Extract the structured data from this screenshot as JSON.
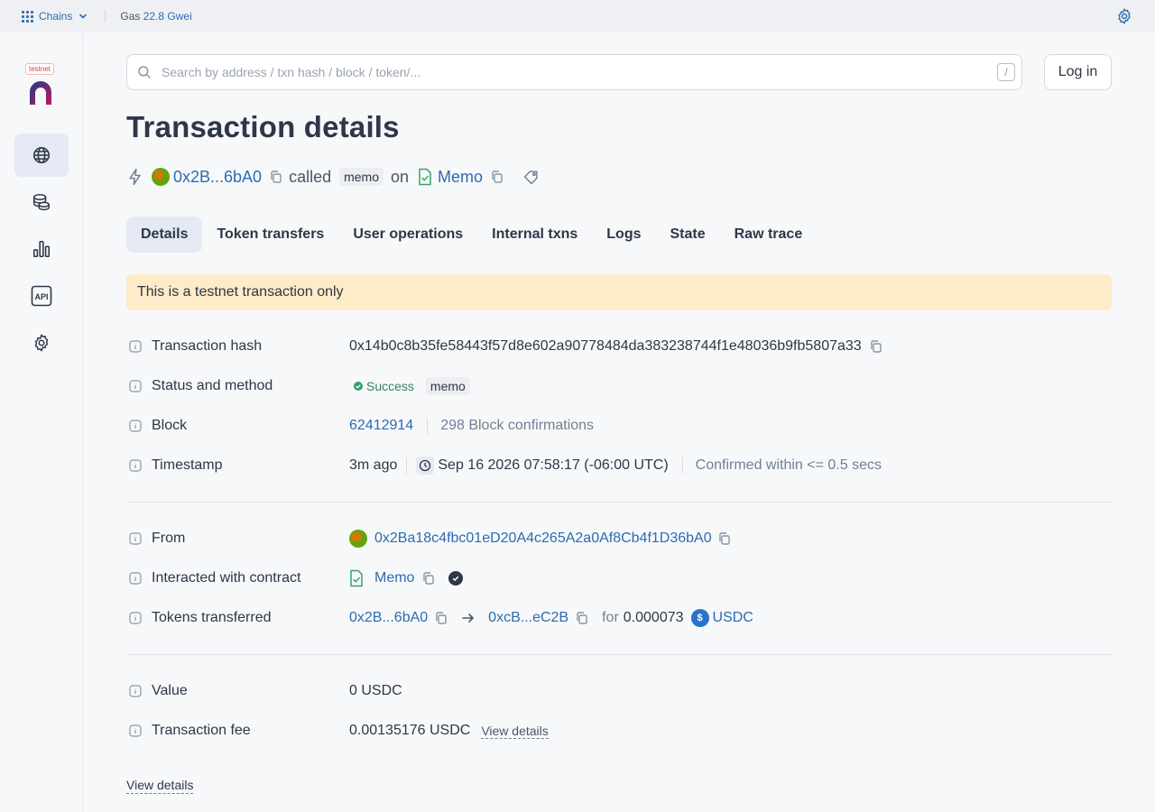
{
  "topbar": {
    "chains_label": "Chains",
    "gas_label": "Gas",
    "gas_value": "22.8 Gwei"
  },
  "sidebar": {
    "logo_tag": "testnet",
    "items": [
      {
        "icon": "globe-icon",
        "active": true
      },
      {
        "icon": "coins-icon"
      },
      {
        "icon": "bar-chart-icon"
      },
      {
        "icon": "api-icon",
        "text": "API"
      },
      {
        "icon": "gear-icon"
      }
    ]
  },
  "search": {
    "placeholder": "Search by address / txn hash / block / token/...",
    "shortcut": "/"
  },
  "header": {
    "login_label": "Log in",
    "title": "Transaction details"
  },
  "summary": {
    "from_short": "0x2B...6bA0",
    "called": "called",
    "method": "memo",
    "on": "on",
    "contract": "Memo"
  },
  "tabs": [
    {
      "label": "Details",
      "active": true
    },
    {
      "label": "Token transfers"
    },
    {
      "label": "User operations"
    },
    {
      "label": "Internal txns"
    },
    {
      "label": "Logs"
    },
    {
      "label": "State"
    },
    {
      "label": "Raw trace"
    }
  ],
  "alert": "This is a testnet transaction only",
  "details": {
    "hash_label": "Transaction hash",
    "hash": "0x14b0c8b35fe58443f57d8e602a90778484da383238744f1e48036b9fb5807a33",
    "status_label": "Status and method",
    "status": "Success",
    "method": "memo",
    "block_label": "Block",
    "block": "62412914",
    "confirmations": "298 Block confirmations",
    "timestamp_label": "Timestamp",
    "ago": "3m ago",
    "datetime": "Sep 16 2026 07:58:17 (-06:00 UTC)",
    "confirmed": "Confirmed within <= 0.5 secs",
    "from_label": "From",
    "from": "0x2Ba18c4fbc01eD20A4c265A2a0Af8Cb4f1D36bA0",
    "contract_label": "Interacted with contract",
    "contract": "Memo",
    "tokens_label": "Tokens transferred",
    "token_from": "0x2B...6bA0",
    "token_to": "0xcB...eC2B",
    "for_label": "for",
    "token_amount": "0.000073",
    "token_symbol": "USDC",
    "value_label": "Value",
    "value": "0 USDC",
    "fee_label": "Transaction fee",
    "fee": "0.00135176 USDC",
    "fee_link": "View details"
  },
  "footer_link": "View details",
  "colors": {
    "accent": "#2b6cb0",
    "alert_bg": "#feebc8",
    "success": "#38a169",
    "usdc": "#2775ca"
  }
}
